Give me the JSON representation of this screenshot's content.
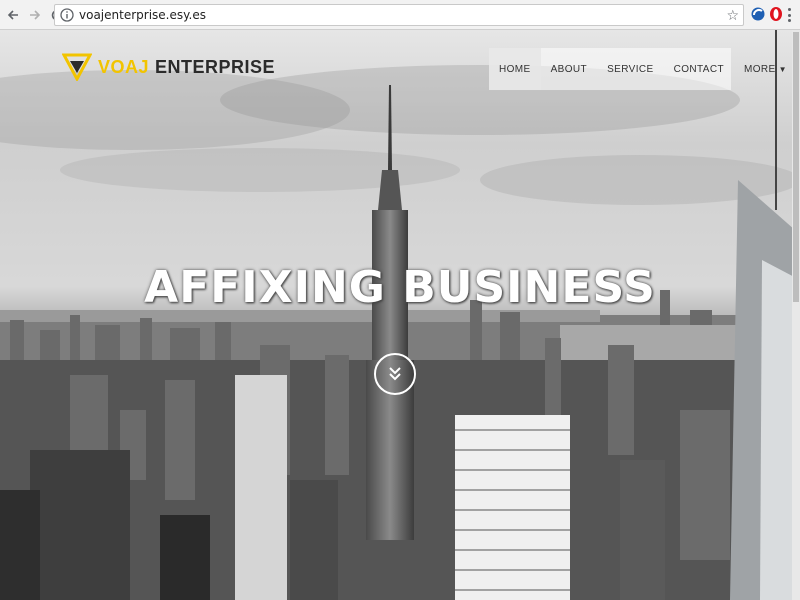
{
  "browser": {
    "url": "voajenterprise.esy.es",
    "back_icon": "back-arrow-icon",
    "forward_icon": "forward-arrow-icon",
    "reload_icon": "reload-icon",
    "star_icon": "bookmark-star-icon"
  },
  "site": {
    "logo_part1": "VOAJ",
    "logo_part2": "ENTERPRISE",
    "menu": [
      {
        "label": "HOME"
      },
      {
        "label": "ABOUT"
      },
      {
        "label": "SERVICE"
      },
      {
        "label": "CONTACT"
      },
      {
        "label": "MORE"
      }
    ],
    "headline": "AFFIXING BUSINESS",
    "scroll_icon": "double-chevron-down-icon"
  },
  "colors": {
    "logo_accent": "#f2c400",
    "logo_dark": "#2b2b2b"
  }
}
